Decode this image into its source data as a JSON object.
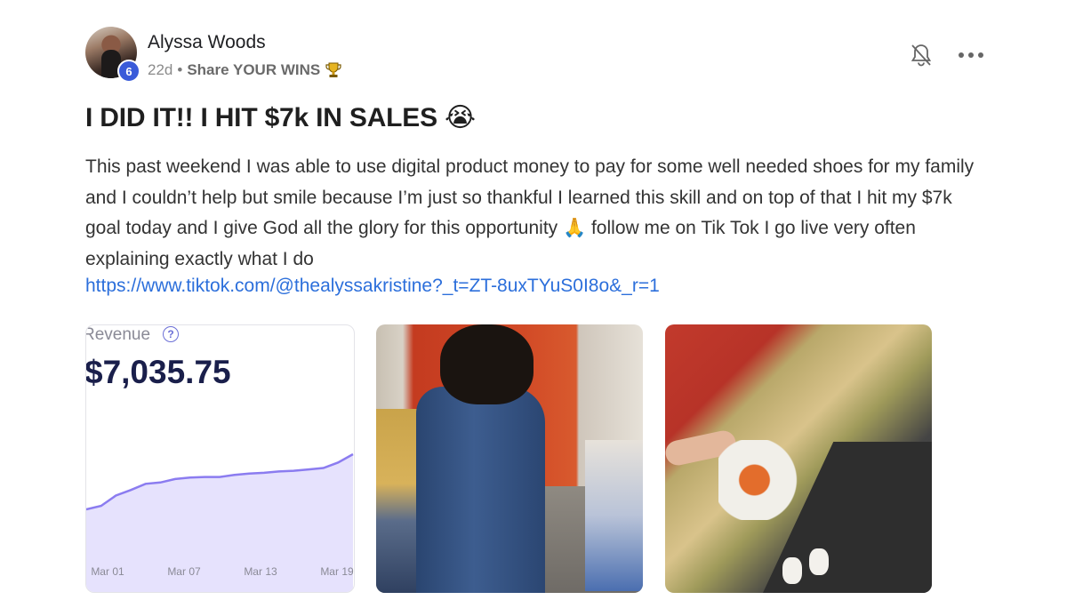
{
  "author": {
    "name": "Alyssa Woods",
    "level": "6",
    "time_ago": "22d",
    "separator": "•",
    "category": "Share YOUR WINS",
    "category_icon": "trophy-icon"
  },
  "post": {
    "title": "I DID IT!! I HIT $7k IN SALES 😭",
    "body": "This past weekend I was able to use digital product money to pay for some well needed shoes for my family and I couldn’t help but smile because I’m just so thankful I learned this skill and on top of that I hit my $7k goal today and I give God all the glory for this opportunity 🙏 follow me on Tik Tok I go live very often explaining exactly what I do",
    "link": "https://www.tiktok.com/@thealyssakristine?_t=ZT-8uxTYuS0I8o&_r=1"
  },
  "actions": {
    "notifications_icon": "bell-off-icon",
    "more_icon": "more-options-icon"
  },
  "media": {
    "chart": {
      "label": "Revenue",
      "value": "$7,035.75",
      "help_icon": "?"
    },
    "photos": [
      "store-checkout-photo",
      "shopping-bag-photo"
    ]
  },
  "chart_data": {
    "type": "area",
    "x_ticks": [
      "Mar 01",
      "Mar 07",
      "Mar 13",
      "Mar 19"
    ],
    "series": [
      {
        "values": [
          0.0,
          0.05,
          0.2,
          0.28,
          0.37,
          0.39,
          0.44,
          0.46,
          0.47,
          0.47,
          0.5,
          0.52,
          0.53,
          0.55,
          0.56,
          0.58,
          0.6,
          0.68,
          0.8
        ]
      }
    ],
    "color": "#8b7cf0",
    "fill": "#e6e2fd",
    "grid": false
  },
  "colors": {
    "link": "#2c6fdb",
    "badge": "#3a5bd9",
    "chart_value": "#1a1f4b"
  }
}
